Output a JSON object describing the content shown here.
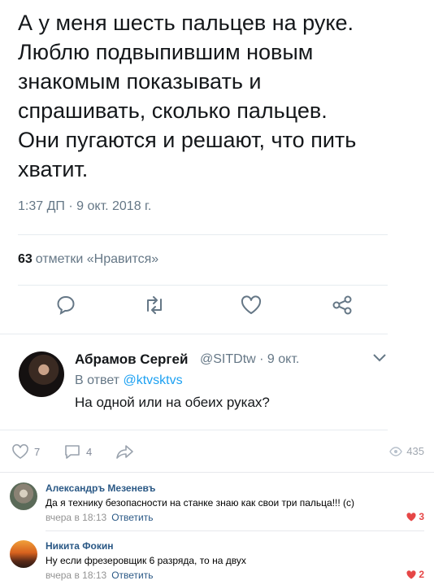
{
  "tweet": {
    "text": "А у меня шесть пальцев на руке.\nЛюблю подвыпившим новым\nзнакомым показывать и\nспрашивать, сколько пальцев.\nОни пугаются и решают, что пить\nхватит.",
    "timestamp": "1:37 ДП · 9 окт. 2018 г.",
    "likes_count": "63",
    "likes_label": "отметки «Нравится»"
  },
  "reply": {
    "name": "Абрамов Сергей",
    "handle": "@SITDtw · 9 окт.",
    "reply_to_prefix": "В ответ",
    "reply_to_handle": "@ktvsktvs",
    "text": "На одной или на обеих руках?"
  },
  "vk_post": {
    "likes": "7",
    "comments": "4",
    "views": "435"
  },
  "comments": [
    {
      "author": "Александръ Мезеневъ",
      "text": "Да я технику безопасности на станке знаю как свои три пальца!!! (с)",
      "time": "вчера в 18:13",
      "reply_label": "Ответить",
      "likes": "3"
    },
    {
      "author": "Никита Фокин",
      "text": "Ну если фрезеровщик 6 разряда, то на двух",
      "time": "вчера в 18:13",
      "reply_label": "Ответить",
      "likes": "2"
    }
  ],
  "colors": {
    "twitter_blue": "#1da1f2",
    "vk_link": "#2a5885",
    "like_red": "#e64646"
  }
}
